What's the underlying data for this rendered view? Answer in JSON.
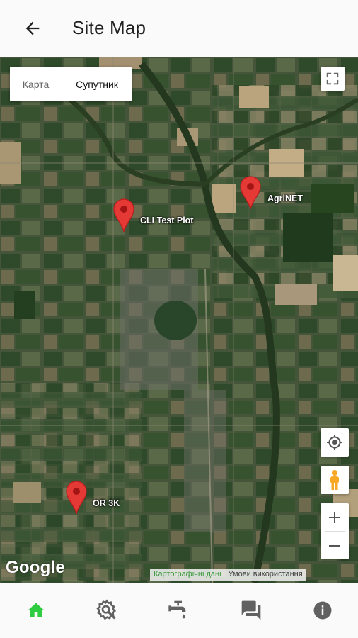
{
  "header": {
    "title": "Site Map"
  },
  "map": {
    "map_type": {
      "map_label": "Карта",
      "satellite_label": "Супутник",
      "selected": "satellite"
    },
    "markers": [
      {
        "label": "CLI Test Plot"
      },
      {
        "label": "AgriNET"
      },
      {
        "label": "OR 3K"
      }
    ],
    "google_logo": "Google",
    "attribution": {
      "map_data": "Картографічні дані",
      "terms": "Умови використання"
    },
    "colors": {
      "marker": "#e53935",
      "marker_dark": "#b71c1c",
      "pegman": "#f9a825"
    }
  },
  "bottom_nav": {
    "items": [
      {
        "icon": "home-icon",
        "active": true
      },
      {
        "icon": "settings-search-icon"
      },
      {
        "icon": "faucet-icon"
      },
      {
        "icon": "chat-icon"
      },
      {
        "icon": "info-icon"
      }
    ],
    "colors": {
      "active": "#2ecc40",
      "inactive": "#616161"
    }
  }
}
